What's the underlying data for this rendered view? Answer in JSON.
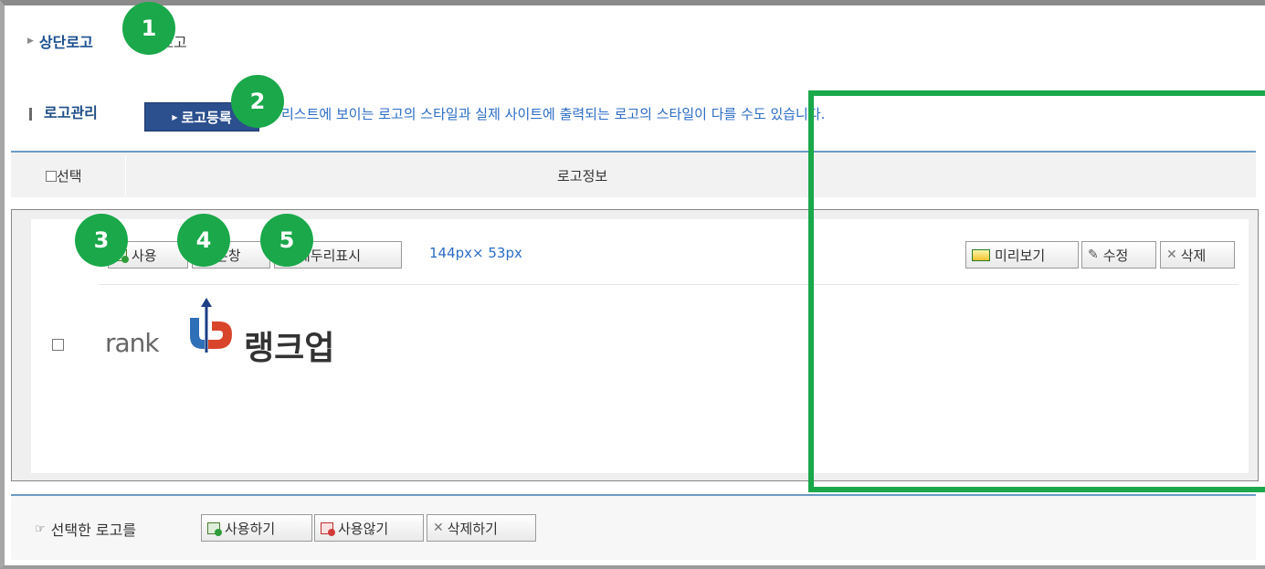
{
  "tabs": {
    "top_logo": "상단로고",
    "bottom_logo": "하단로고"
  },
  "section": {
    "title": "로고관리",
    "register_button": "로고등록",
    "notice": "리스트에 보이는 로고의 스타일과 실제 사이트에 출력되는 로고의 스타일이 다를 수도 있습니다."
  },
  "table": {
    "select_header": "선택",
    "info_header": "로고정보"
  },
  "logo_item": {
    "buttons": {
      "use": "사용",
      "new_window": "본창",
      "show_border": "테두리표시",
      "preview": "미리보기",
      "edit": "수정",
      "delete": "삭제"
    },
    "size": "144px× 53px",
    "logo_text_en": "rank",
    "logo_text_kr": "랭크업"
  },
  "bulk_actions": {
    "label": "선택한 로고를",
    "use": "사용하기",
    "unuse": "사용않기",
    "delete": "삭제하기"
  },
  "annotations": [
    "1",
    "2",
    "3",
    "4",
    "5"
  ],
  "colors": {
    "annotation_green": "#1aa84a",
    "header_blue": "#2c4f8d",
    "link_blue": "#2b6cc4"
  }
}
